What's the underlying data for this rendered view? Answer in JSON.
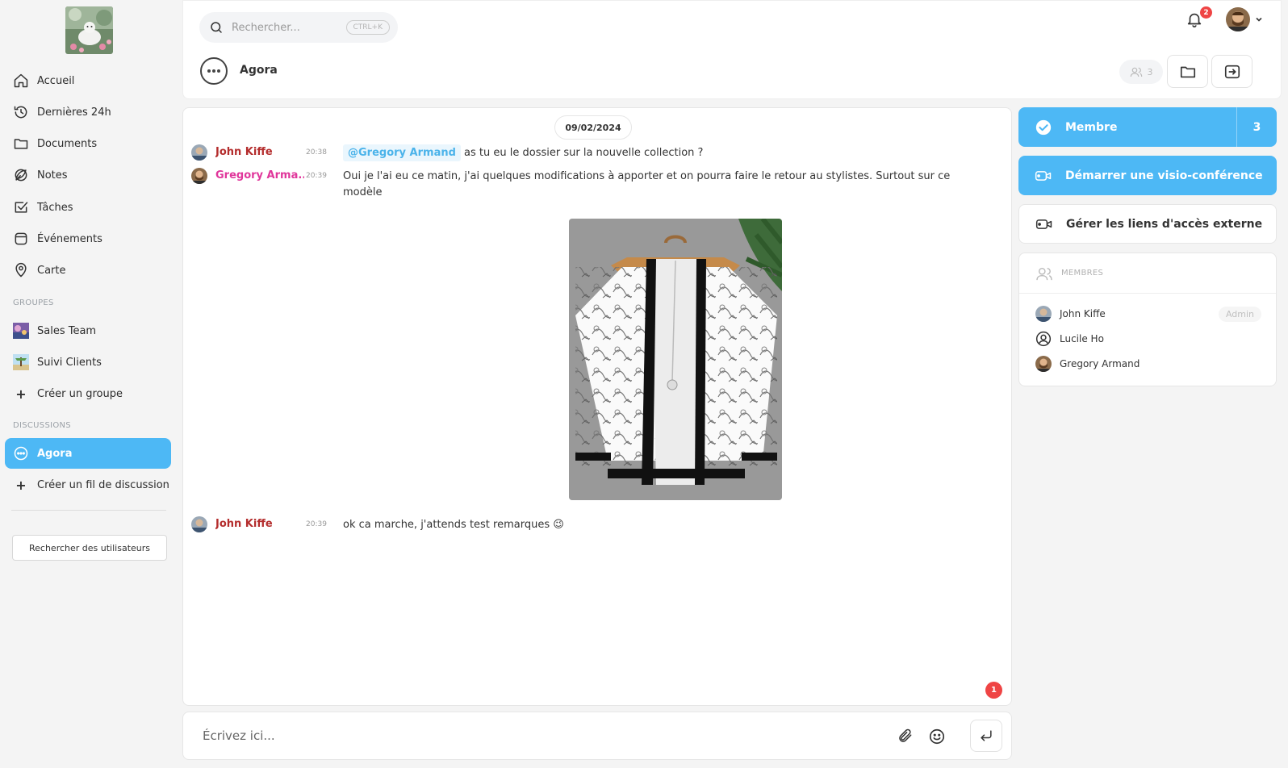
{
  "sidebar": {
    "nav": [
      {
        "label": "Accueil",
        "icon": "home-icon"
      },
      {
        "label": "Dernières 24h",
        "icon": "clock-history-icon"
      },
      {
        "label": "Documents",
        "icon": "folder-icon"
      },
      {
        "label": "Notes",
        "icon": "notes-icon"
      },
      {
        "label": "Tâches",
        "icon": "task-check-icon"
      },
      {
        "label": "Événements",
        "icon": "calendar-icon"
      },
      {
        "label": "Carte",
        "icon": "map-pin-icon"
      }
    ],
    "groups_title": "GROUPES",
    "groups": [
      {
        "label": "Sales Team"
      },
      {
        "label": "Suivi Clients"
      }
    ],
    "create_group": "Créer un groupe",
    "discussions_title": "DISCUSSIONS",
    "discussions": [
      {
        "label": "Agora",
        "active": true
      }
    ],
    "create_thread": "Créer un fil de discussion",
    "search_users": "Rechercher des utilisateurs"
  },
  "header": {
    "search_placeholder": "Rechercher...",
    "search_shortcut": "CTRL+K",
    "notification_count": "2",
    "channel_name": "Agora",
    "participants_count": "3"
  },
  "chat": {
    "date": "09/02/2024",
    "messages": [
      {
        "author": "John Kiffe",
        "author_color": "#b42d2d",
        "time": "20:38",
        "mention": "@Gregory Armand",
        "text": "as tu eu le dossier sur la nouvelle collection ?"
      },
      {
        "author": "Gregory Arma...",
        "author_color": "#e0369b",
        "time": "20:39",
        "text": "Oui je l'ai eu ce matin, j'ai quelques modifications à apporter et on pourra faire le retour au stylistes. Surtout sur ce modèle"
      },
      {
        "author": "John Kiffe",
        "author_color": "#b42d2d",
        "time": "20:39",
        "text": "ok ca marche, j'attends test remarques 😉"
      }
    ],
    "unread_count": "1"
  },
  "composer": {
    "placeholder": "Écrivez ici..."
  },
  "right_panel": {
    "member_button": "Membre",
    "member_count": "3",
    "video_button": "Démarrer une visio-conférence",
    "external_links_button": "Gérer les liens d'accès externe",
    "members_title": "MEMBRES",
    "members": [
      {
        "name": "John Kiffe",
        "role": "Admin"
      },
      {
        "name": "Lucile Ho",
        "role": ""
      },
      {
        "name": "Gregory Armand",
        "role": ""
      }
    ]
  },
  "colors": {
    "accent": "#4db8f5",
    "badge": "#ef4444",
    "mention_text": "#4bb3ea"
  }
}
